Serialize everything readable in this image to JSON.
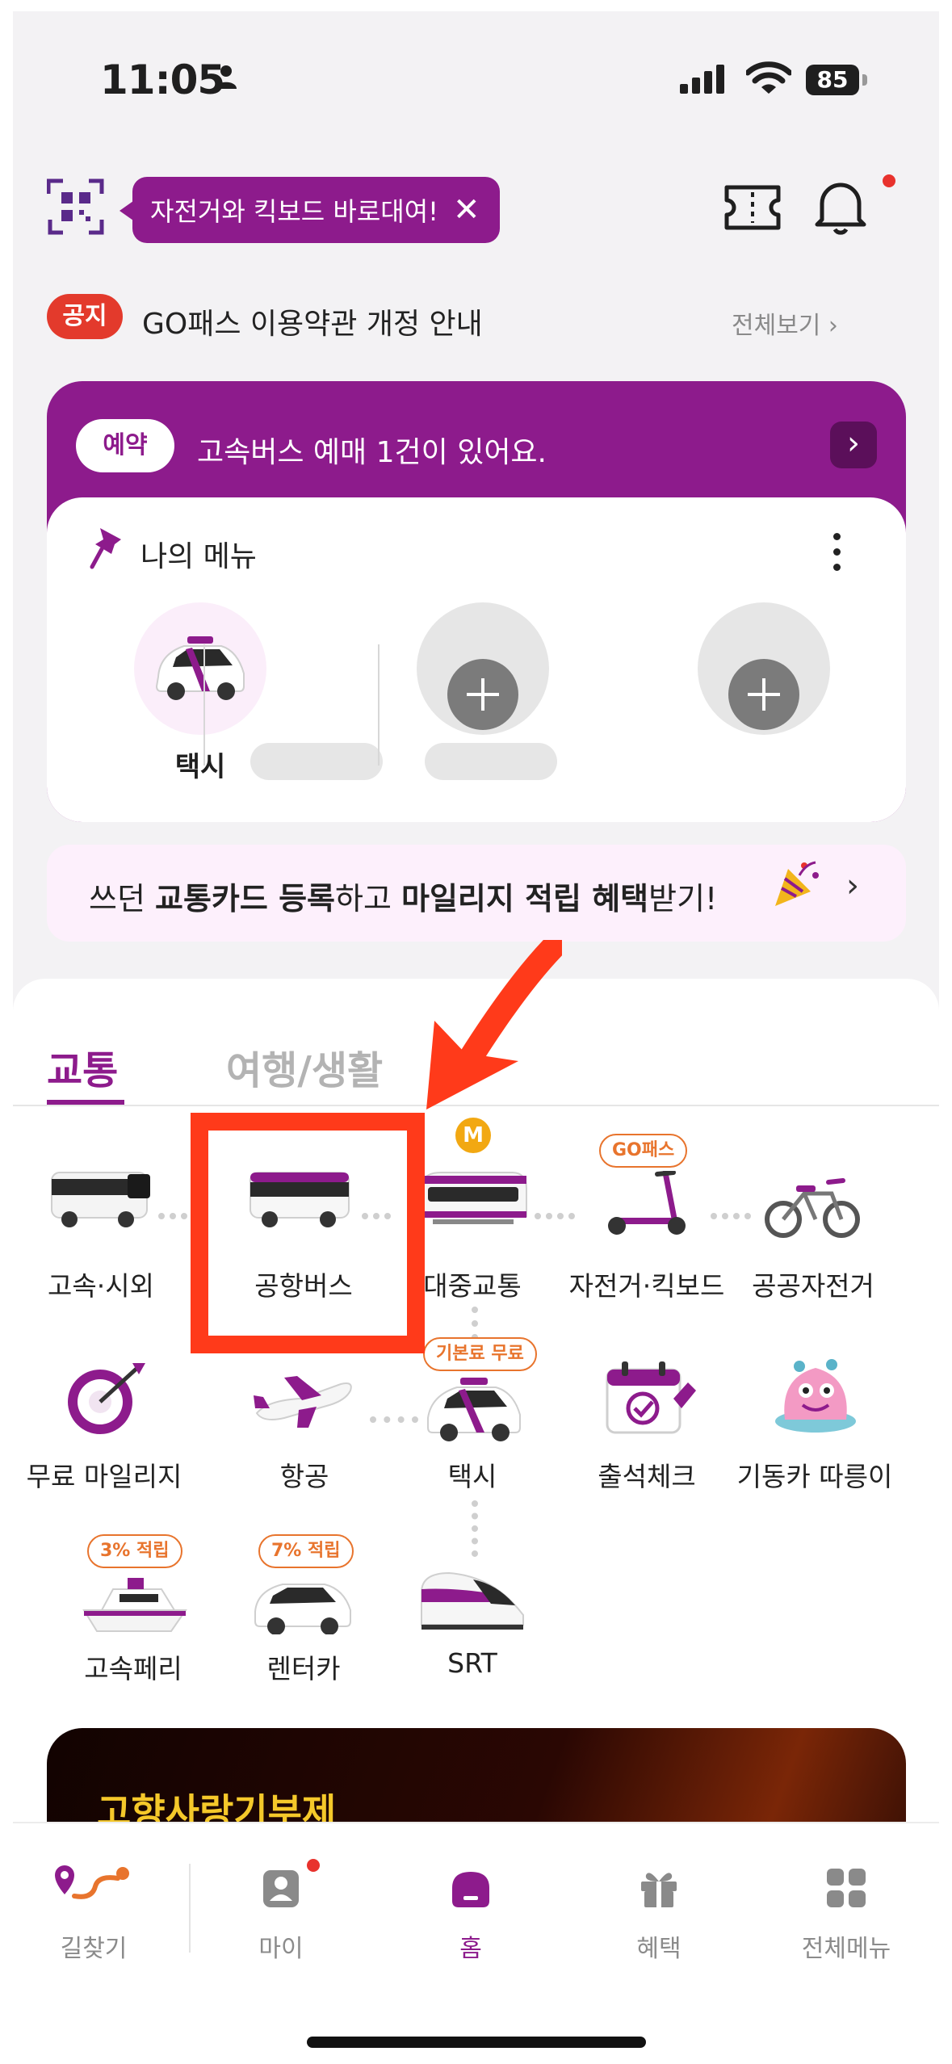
{
  "status_bar": {
    "time": "11:05",
    "battery": "85"
  },
  "header": {
    "promo_text": "자전거와 킥보드 바로대여!",
    "close_glyph": "✕"
  },
  "notice": {
    "badge": "공지",
    "text": "GO패스 이용약관 개정 안내",
    "view_all": "전체보기 ›"
  },
  "reservation": {
    "badge": "예약",
    "text": "고속버스 예매 1건이 있어요.",
    "arrow": "›"
  },
  "my_menu": {
    "title": "나의 메뉴",
    "items": [
      {
        "label": "택시"
      }
    ]
  },
  "traffic_card_banner": {
    "part1": "쓰던 ",
    "part2": "교통카드 등록",
    "part3": "하고 ",
    "part4": "마일리지 적립 혜택",
    "part5": "받기!",
    "arrow": "›"
  },
  "tabs": {
    "transport": "교통",
    "travel_life": "여행/생활"
  },
  "transport_items": {
    "express_bus": "고속·시외",
    "airport_bus": "공항버스",
    "public_transit": "대중교통",
    "bike_kickboard": "자전거·킥보드",
    "public_bike": "공공자전거",
    "free_mileage": "무료 마일리지",
    "flight": "항공",
    "taxi": "택시",
    "attendance": "출석체크",
    "kidongka": "기동카 따릉이",
    "ferry": "고속페리",
    "rental_car": "렌터카",
    "srt": "SRT"
  },
  "tags": {
    "gopass": "GO패스",
    "base_fee_free": "기본료 무료",
    "ferry_reward": "3% 적립",
    "rental_reward": "7% 적립",
    "metro_badge": "M"
  },
  "banner": {
    "title": "고향사랑기부제"
  },
  "bottom_nav": {
    "items": [
      {
        "label": "길찾기"
      },
      {
        "label": "마이"
      },
      {
        "label": "홈"
      },
      {
        "label": "혜택"
      },
      {
        "label": "전체메뉴"
      }
    ],
    "active": "홈"
  },
  "colors": {
    "brand": "#8d1b8c",
    "notice_red": "#e33a2c",
    "tag_orange": "#e8742d",
    "annotation_red": "#ff3a1a"
  }
}
